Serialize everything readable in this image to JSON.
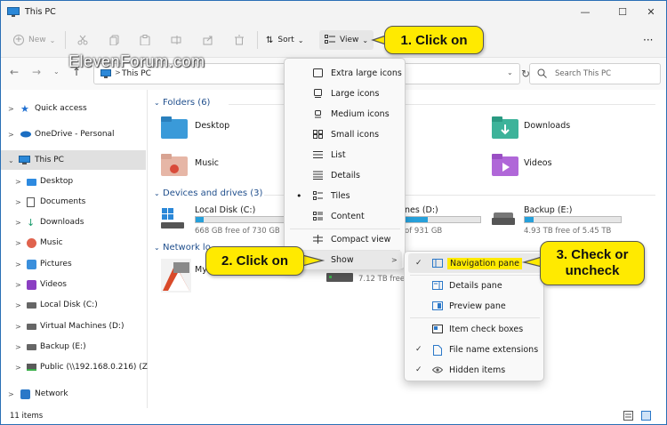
{
  "window": {
    "title": "This PC",
    "minimize": "—",
    "maximize": "☐",
    "close": "✕"
  },
  "toolbar": {
    "new_label": "New",
    "new_arrow": "⌄",
    "sort_label": "Sort",
    "sort_arrow": "⌄",
    "view_label": "View",
    "view_arrow": "⌄"
  },
  "address": {
    "path": "This PC",
    "chevron": ">",
    "dropdown": "⌄",
    "search_placeholder": "Search This PC"
  },
  "nav": {
    "items": [
      {
        "label": "Quick access",
        "chev": ">"
      },
      {
        "label": "OneDrive - Personal",
        "chev": ">"
      },
      {
        "label": "This PC",
        "chev": "⌄"
      },
      {
        "label": "Desktop",
        "chev": ">"
      },
      {
        "label": "Documents",
        "chev": ">"
      },
      {
        "label": "Downloads",
        "chev": ">"
      },
      {
        "label": "Music",
        "chev": ">"
      },
      {
        "label": "Pictures",
        "chev": ">"
      },
      {
        "label": "Videos",
        "chev": ">"
      },
      {
        "label": "Local Disk (C:)",
        "chev": ">"
      },
      {
        "label": "Virtual Machines (D:)",
        "chev": ">"
      },
      {
        "label": "Backup (E:)",
        "chev": ">"
      },
      {
        "label": "Public (\\\\192.168.0.216) (Z:)",
        "chev": ">"
      },
      {
        "label": "Network",
        "chev": ">"
      }
    ]
  },
  "main": {
    "folders_header": "Folders (6)",
    "folders": [
      {
        "label": "Desktop"
      },
      {
        "label": "Music"
      },
      {
        "label": "Downloads"
      },
      {
        "label": "Videos"
      }
    ],
    "drives_header": "Devices and drives (3)",
    "drives": [
      {
        "label": "Local Disk (C:)",
        "free": "668 GB free of 730 GB",
        "used_fraction": 0.085
      },
      {
        "label": "nes (D:)",
        "free": "of 931 GB",
        "used_fraction": 0.3
      },
      {
        "label": "Backup (E:)",
        "free": "4.93 TB free of 5.45 TB",
        "used_fraction": 0.095
      }
    ],
    "network_header": "Network lo",
    "network_item": "My",
    "network_free": "7.12 TB free"
  },
  "view_menu": {
    "items": [
      {
        "label": "Extra large icons",
        "bullet": ""
      },
      {
        "label": "Large icons",
        "bullet": ""
      },
      {
        "label": "Medium icons",
        "bullet": ""
      },
      {
        "label": "Small icons",
        "bullet": ""
      },
      {
        "label": "List",
        "bullet": ""
      },
      {
        "label": "Details",
        "bullet": ""
      },
      {
        "label": "Tiles",
        "bullet": "•"
      },
      {
        "label": "Content",
        "bullet": ""
      },
      {
        "label": "Compact view",
        "bullet": ""
      },
      {
        "label": "Show",
        "bullet": "",
        "arrow": ">"
      }
    ]
  },
  "show_menu": {
    "items": [
      {
        "label": "Navigation pane",
        "check": "✓"
      },
      {
        "label": "Details pane",
        "check": ""
      },
      {
        "label": "Preview pane",
        "check": ""
      },
      {
        "label": "Item check boxes",
        "check": ""
      },
      {
        "label": "File name extensions",
        "check": "✓"
      },
      {
        "label": "Hidden items",
        "check": "✓"
      }
    ]
  },
  "callouts": {
    "c1": "1. Click on",
    "c2": "2. Click on",
    "c3": "3. Check or uncheck"
  },
  "watermark": "ElevenForum.com",
  "status": {
    "count": "11 items"
  },
  "colors": {
    "accent": "#0067c0",
    "callout": "#ffea00",
    "drive_bar": "#26a0da"
  }
}
